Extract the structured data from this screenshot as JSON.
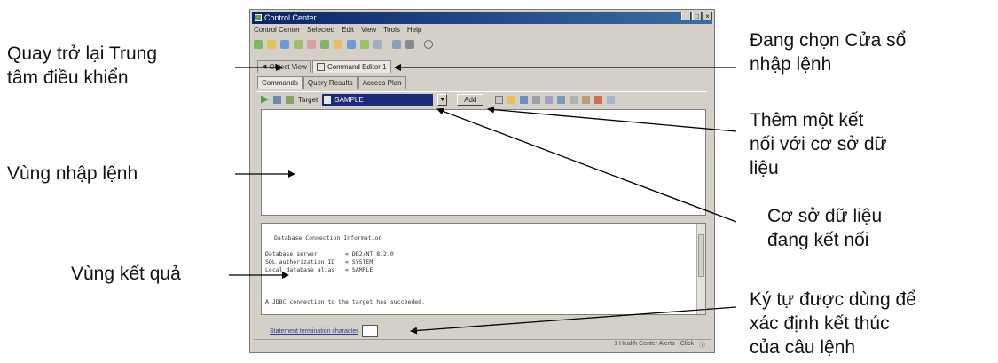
{
  "callouts": {
    "return_control_center": [
      "Quay trở lại Trung",
      "tâm điều khiển"
    ],
    "command_input_area": "Vùng nhập lệnh",
    "result_area": "Vùng kết quả",
    "selecting_window": [
      "Đang chọn Cửa sổ",
      "nhập lệnh"
    ],
    "add_connection": [
      "Thêm một kết",
      "nối với cơ sở dữ",
      "liệu"
    ],
    "connected_db": [
      "Cơ sở dữ liệu",
      "đang kết nối"
    ],
    "terminator_char": [
      "Ký tự được dùng để",
      "xác định kết thúc",
      "của câu lệnh"
    ]
  },
  "window": {
    "title": "Control Center",
    "menu": [
      "Control Center",
      "Selected",
      "Edit",
      "View",
      "Tools",
      "Help"
    ],
    "tabs": [
      "Object View",
      "Command Editor 1"
    ],
    "subtabs": [
      "Commands",
      "Query Results",
      "Access Plan"
    ],
    "target_label": "Target",
    "target_value": "SAMPLE",
    "add_label": "Add",
    "results": {
      "header": "Database Connection Information",
      "server": "Database server        = DB2/NT 8.2.0",
      "auth": "SQL authorization ID   = SYSTEM",
      "alias": "Local database alias   = SAMPLE",
      "message": "A JDBC connection to the target has succeeded."
    },
    "terminator_label": "Statement termination character",
    "status_text": "1 Health Center Alerts - Click"
  },
  "colors": {
    "title_bar": "#0a246a",
    "target_bg": "#1c2a7a"
  }
}
